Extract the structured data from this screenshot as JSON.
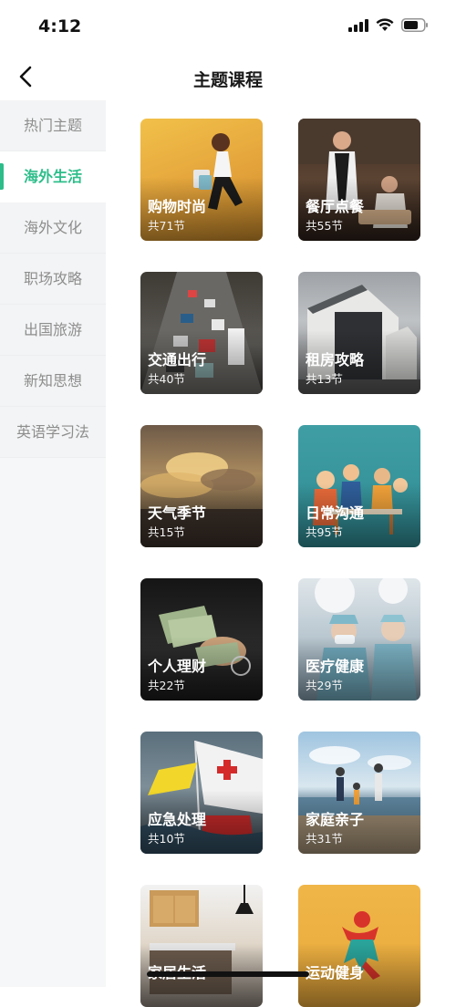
{
  "status_bar": {
    "time": "4:12"
  },
  "header": {
    "title": "主题课程"
  },
  "sidebar": {
    "items": [
      {
        "label": "热门主题",
        "active": false
      },
      {
        "label": "海外生活",
        "active": true
      },
      {
        "label": "海外文化",
        "active": false
      },
      {
        "label": "职场攻略",
        "active": false
      },
      {
        "label": "出国旅游",
        "active": false
      },
      {
        "label": "新知思想",
        "active": false
      },
      {
        "label": "英语学习法",
        "active": false
      }
    ]
  },
  "courses": [
    {
      "title": "购物时尚",
      "count": "共71节"
    },
    {
      "title": "餐厅点餐",
      "count": "共55节"
    },
    {
      "title": "交通出行",
      "count": "共40节"
    },
    {
      "title": "租房攻略",
      "count": "共13节"
    },
    {
      "title": "天气季节",
      "count": "共15节"
    },
    {
      "title": "日常沟通",
      "count": "共95节"
    },
    {
      "title": "个人理财",
      "count": "共22节"
    },
    {
      "title": "医疗健康",
      "count": "共29节"
    },
    {
      "title": "应急处理",
      "count": "共10节"
    },
    {
      "title": "家庭亲子",
      "count": "共31节"
    },
    {
      "title": "家居生活",
      "count": ""
    },
    {
      "title": "运动健身",
      "count": ""
    }
  ],
  "colors": {
    "accent": "#2dbd8a",
    "sidebar_bg": "#f3f4f5"
  }
}
